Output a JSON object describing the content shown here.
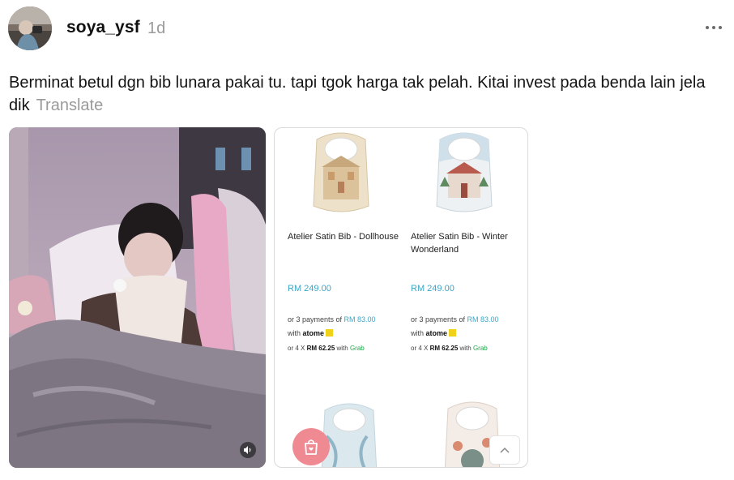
{
  "post": {
    "username": "soya_ysf",
    "time": "1d",
    "caption": "Berminat betul dgn bib lunara pakai tu. tapi tgok harga tak pelah. Kitai invest pada benda lain jela dik",
    "translate_label": "Translate"
  },
  "shop": {
    "products": [
      {
        "name": "Atelier Satin Bib - Dollhouse",
        "price": "RM 249.00",
        "installment_prefix": "or 3 payments of ",
        "installment_amount": "RM 83.00",
        "with_label": "with",
        "atome_label": "atome",
        "grab_prefix": "or 4 X ",
        "grab_amount": "RM 62.25",
        "grab_with": " with ",
        "grab_label": "Grab"
      },
      {
        "name": "Atelier Satin Bib - Winter Wonderland",
        "price": "RM 249.00",
        "installment_prefix": "or 3 payments of ",
        "installment_amount": "RM 83.00",
        "with_label": "with",
        "atome_label": "atome",
        "grab_prefix": "or 4 X ",
        "grab_amount": "RM 62.25",
        "grab_with": " with ",
        "grab_label": "Grab"
      }
    ]
  },
  "icons": [
    "more-icon",
    "mute-icon",
    "shopping-bag-heart-icon",
    "chevron-up-icon"
  ],
  "colors": {
    "price": "#3aa6c8",
    "fab": "#ef8a93",
    "muted": "#9a9a9a",
    "grab": "#1fa34a"
  }
}
